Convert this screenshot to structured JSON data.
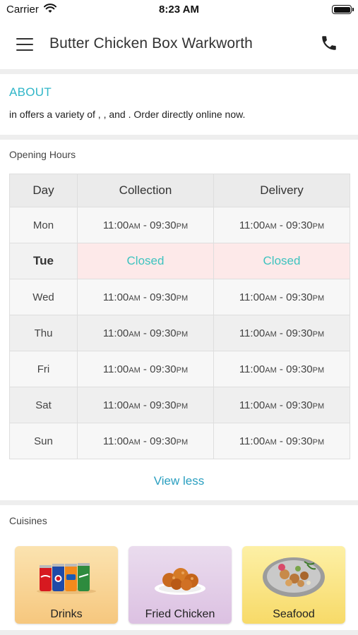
{
  "status_bar": {
    "carrier": "Carrier",
    "time": "8:23 AM"
  },
  "header": {
    "title": "Butter Chicken Box Warkworth",
    "menu_icon": "hamburger-menu-icon",
    "call_icon": "phone-icon"
  },
  "about": {
    "title": "ABOUT",
    "text": "in  offers a variety of , ,  and  . Order directly online now."
  },
  "opening_hours": {
    "label": "Opening Hours",
    "columns": [
      "Day",
      "Collection",
      "Delivery"
    ],
    "rows": [
      {
        "day": "Mon",
        "collection": {
          "open": "11:00",
          "open_suffix": "AM",
          "sep": " - ",
          "close": "09:30",
          "close_suffix": "PM"
        },
        "delivery": {
          "open": "11:00",
          "open_suffix": "AM",
          "sep": " - ",
          "close": "09:30",
          "close_suffix": "PM"
        }
      },
      {
        "day": "Tue",
        "collection_closed": "Closed",
        "delivery_closed": "Closed"
      },
      {
        "day": "Wed",
        "collection": {
          "open": "11:00",
          "open_suffix": "AM",
          "sep": " - ",
          "close": "09:30",
          "close_suffix": "PM"
        },
        "delivery": {
          "open": "11:00",
          "open_suffix": "AM",
          "sep": " - ",
          "close": "09:30",
          "close_suffix": "PM"
        }
      },
      {
        "day": "Thu",
        "collection": {
          "open": "11:00",
          "open_suffix": "AM",
          "sep": " - ",
          "close": "09:30",
          "close_suffix": "PM"
        },
        "delivery": {
          "open": "11:00",
          "open_suffix": "AM",
          "sep": " - ",
          "close": "09:30",
          "close_suffix": "PM"
        }
      },
      {
        "day": "Fri",
        "collection": {
          "open": "11:00",
          "open_suffix": "AM",
          "sep": " - ",
          "close": "09:30",
          "close_suffix": "PM"
        },
        "delivery": {
          "open": "11:00",
          "open_suffix": "AM",
          "sep": " - ",
          "close": "09:30",
          "close_suffix": "PM"
        }
      },
      {
        "day": "Sat",
        "collection": {
          "open": "11:00",
          "open_suffix": "AM",
          "sep": " - ",
          "close": "09:30",
          "close_suffix": "PM"
        },
        "delivery": {
          "open": "11:00",
          "open_suffix": "AM",
          "sep": " - ",
          "close": "09:30",
          "close_suffix": "PM"
        }
      },
      {
        "day": "Sun",
        "collection": {
          "open": "11:00",
          "open_suffix": "AM",
          "sep": " - ",
          "close": "09:30",
          "close_suffix": "PM"
        },
        "delivery": {
          "open": "11:00",
          "open_suffix": "AM",
          "sep": " - ",
          "close": "09:30",
          "close_suffix": "PM"
        }
      }
    ],
    "view_less": "View less"
  },
  "cuisines": {
    "label": "Cuisines",
    "items": [
      {
        "name": "Drinks",
        "icon": "soda-cans-icon"
      },
      {
        "name": "Fried Chicken",
        "icon": "fried-chicken-plate-icon"
      },
      {
        "name": "Seafood",
        "icon": "seafood-bowl-icon"
      }
    ]
  },
  "colors": {
    "accent_teal": "#30b6c8",
    "link_blue": "#2a9fc0",
    "closed_bg": "#fde9e9",
    "closed_text": "#3ec3bf"
  }
}
